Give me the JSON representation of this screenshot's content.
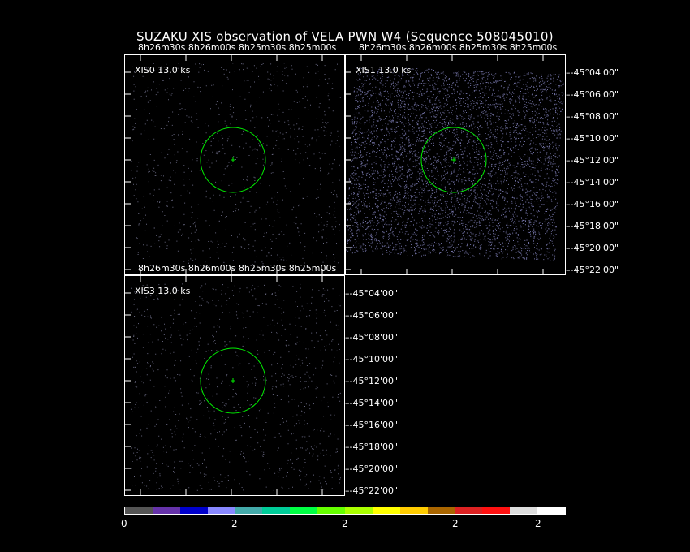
{
  "title": "SUZAKU XIS observation of VELA PWN W4  (Sequence 508045010)",
  "ra_labels": [
    "8h26m30s",
    "8h26m00s",
    "8h25m30s",
    "8h25m00s"
  ],
  "dec_labels": [
    "-45°04'00\"",
    "-45°06'00\"",
    "-45°08'00\"",
    "-45°10'00\"",
    "-45°12'00\"",
    "-45°14'00\"",
    "-45°16'00\"",
    "-45°18'00\"",
    "-45°20'00\"",
    "-45°22'00\""
  ],
  "panels": [
    {
      "id": "xis0",
      "label": "XIS0  13.0 ks"
    },
    {
      "id": "xis1",
      "label": "XIS1  13.0 ks"
    },
    {
      "id": "xis3",
      "label": "XIS3  13.0 ks"
    }
  ],
  "colorbar": {
    "colors": [
      "#555555",
      "#6633aa",
      "#0000cc",
      "#8888ff",
      "#44aaaa",
      "#00cc99",
      "#00ff44",
      "#66ff00",
      "#aaff00",
      "#ffff00",
      "#ffcc00",
      "#aa6600",
      "#dd2222",
      "#ff1111",
      "#dddddd",
      "#ffffff"
    ],
    "labels": [
      "0",
      "2",
      "2",
      "2",
      "2"
    ]
  },
  "region_color": "#00ee00"
}
